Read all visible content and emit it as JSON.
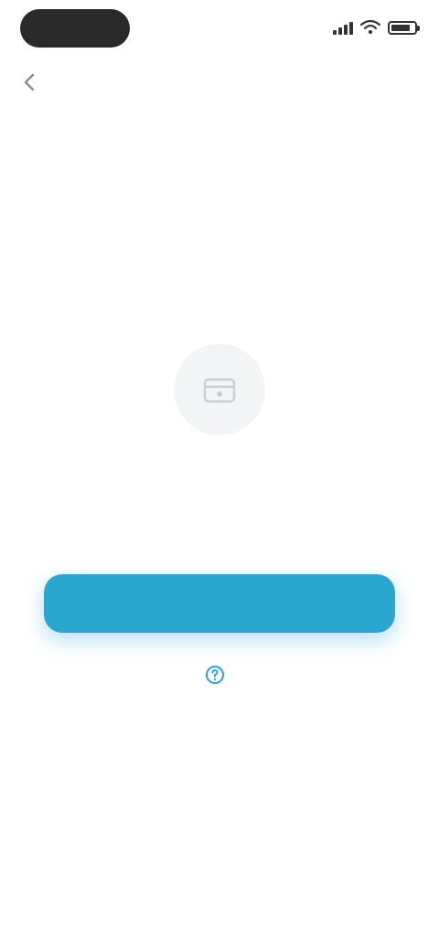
{
  "status_bar": {
    "time": "",
    "icons": [
      "signal-icon",
      "wifi-icon",
      "battery-icon"
    ]
  },
  "nav": {
    "back_label": "",
    "title": "",
    "action_label": ""
  },
  "empty_state": {
    "icon": "empty-state-icon",
    "title": "",
    "description": ""
  },
  "actions": {
    "primary_label": "",
    "secondary_label": "",
    "secondary_icon": "help-icon"
  },
  "colors": {
    "accent": "#2aa7cf",
    "title_text": "#3d4f5c",
    "muted_text": "#9aa3aa",
    "background": "#ffffff"
  }
}
